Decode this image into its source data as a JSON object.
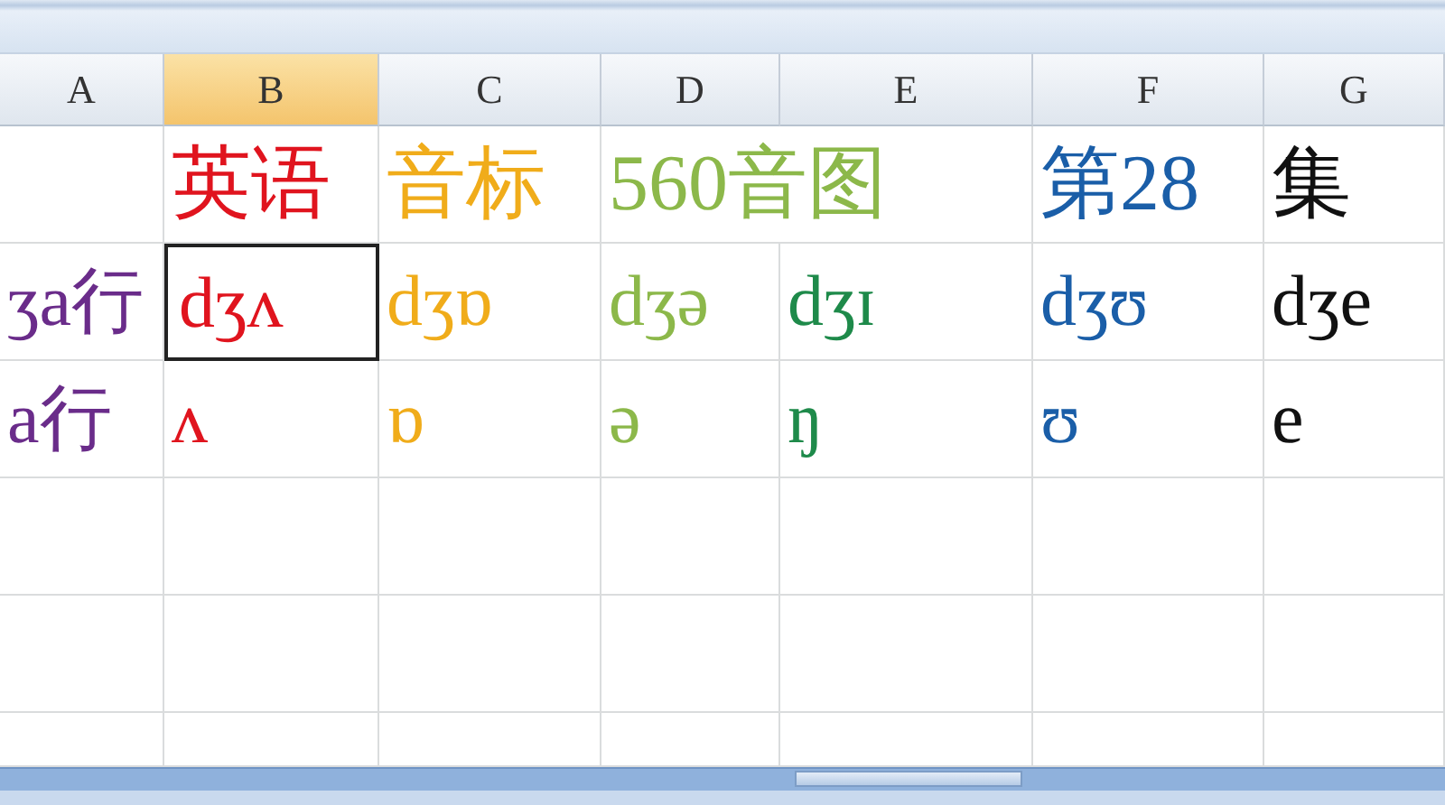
{
  "columns": [
    {
      "label": "A",
      "selected": false
    },
    {
      "label": "B",
      "selected": true
    },
    {
      "label": "C",
      "selected": false
    },
    {
      "label": "D",
      "selected": false
    },
    {
      "label": "E",
      "selected": false
    },
    {
      "label": "F",
      "selected": false
    },
    {
      "label": "G",
      "selected": false
    }
  ],
  "rows": [
    {
      "cells": [
        {
          "kind": "blank"
        },
        {
          "kind": "text",
          "text": "英语",
          "color": "#e0141e",
          "selected": false
        },
        {
          "kind": "text",
          "text": "音标",
          "color": "#f0ac1a",
          "selected": false
        },
        {
          "kind": "text",
          "text": "560音图",
          "color": "#8cb84a",
          "selected": false
        },
        {
          "kind": "covered"
        },
        {
          "kind": "text",
          "text": "第28",
          "color": "#1a5ea8",
          "selected": false
        },
        {
          "kind": "text",
          "text": "集",
          "color": "#111111",
          "selected": false
        }
      ]
    },
    {
      "cells": [
        {
          "kind": "text",
          "text": "ʒa行",
          "color": "#6a2c8a",
          "selected": false
        },
        {
          "kind": "text",
          "text": "dʒʌ",
          "color": "#e0141e",
          "selected": true
        },
        {
          "kind": "text",
          "text": "dʒɒ",
          "color": "#f0ac1a",
          "selected": false
        },
        {
          "kind": "text",
          "text": "dʒə",
          "color": "#8cb84a",
          "selected": false
        },
        {
          "kind": "text",
          "text": "dʒɪ",
          "color": "#1e8a4a",
          "selected": false
        },
        {
          "kind": "text",
          "text": "dʒʊ",
          "color": "#1a5ea8",
          "selected": false
        },
        {
          "kind": "text",
          "text": "dʒe",
          "color": "#111111",
          "selected": false
        }
      ]
    },
    {
      "cells": [
        {
          "kind": "text",
          "text": "a行",
          "color": "#6a2c8a",
          "selected": false
        },
        {
          "kind": "text",
          "text": "ʌ",
          "color": "#e0141e",
          "selected": false
        },
        {
          "kind": "text",
          "text": "ɒ",
          "color": "#f0ac1a",
          "selected": false
        },
        {
          "kind": "text",
          "text": "ə",
          "color": "#8cb84a",
          "selected": false
        },
        {
          "kind": "text",
          "text": "ŋ",
          "color": "#1e8a4a",
          "selected": false
        },
        {
          "kind": "text",
          "text": "ʊ",
          "color": "#1a5ea8",
          "selected": false
        },
        {
          "kind": "text",
          "text": "e",
          "color": "#111111",
          "selected": false
        }
      ]
    }
  ]
}
